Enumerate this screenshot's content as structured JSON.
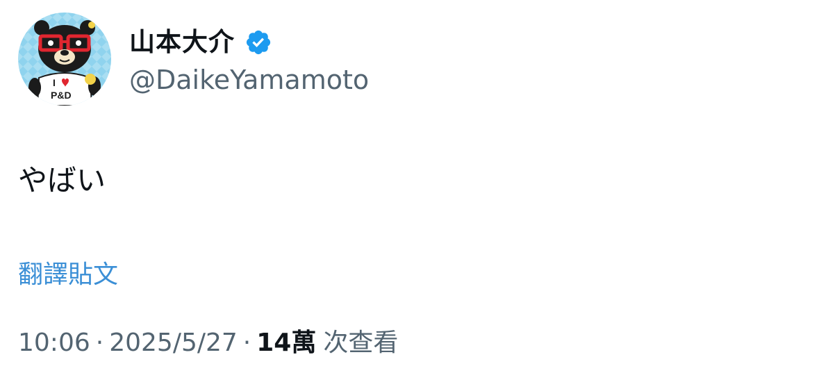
{
  "user": {
    "display_name": "山本大介",
    "handle": "@DaikeYamamoto",
    "verified": true,
    "verified_icon": "verified-badge-icon",
    "avatar": {
      "icon": "bear-with-glasses-avatar",
      "shirt_text_top": "I",
      "shirt_text_bottom": "P&D"
    }
  },
  "tweet": {
    "text": "やばい",
    "translate_label": "翻譯貼文"
  },
  "meta": {
    "time": "10:06",
    "separator": "·",
    "date": "2025/5/27",
    "views_count": "14萬",
    "views_label": "次查看"
  },
  "colors": {
    "text_primary": "#0f1419",
    "text_secondary": "#536471",
    "link": "#3b8fd6",
    "verified": "#1d9bf0",
    "avatar_bg": "#8fd3ee",
    "glasses": "#e0262f"
  }
}
